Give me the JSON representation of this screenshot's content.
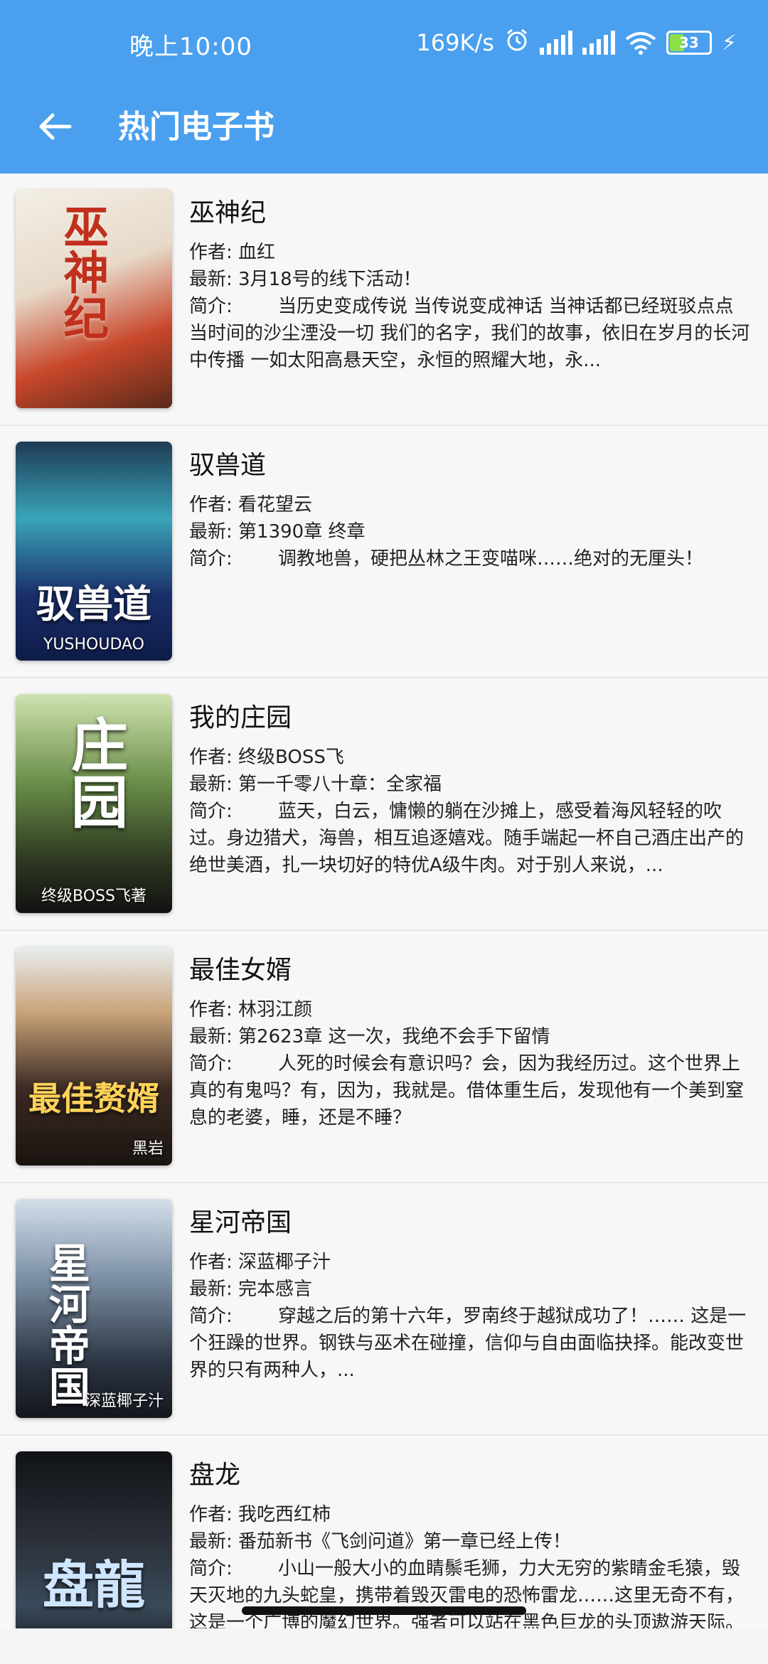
{
  "status": {
    "time": "晚上10:00",
    "speed": "169K/s",
    "battery": "33",
    "icons": [
      "alarm-icon",
      "signal-hd-icon",
      "signal-hd-icon",
      "wifi-icon",
      "battery-icon",
      "charging-icon"
    ]
  },
  "appbar": {
    "title": "热门电子书",
    "back_icon": "arrow-left-icon"
  },
  "labels": {
    "author": "作者: ",
    "latest": "最新: ",
    "intro": "简介: "
  },
  "books": [
    {
      "title": "巫神纪",
      "author": "血红",
      "latest": "3月18号的线下活动！",
      "intro": "当历史变成传说 当传说变成神话 当神话都已经斑驳点点 当时间的沙尘湮没一切 我们的名字，我们的故事，依旧在岁月的长河中传播 一如太阳高悬天空，永恒的照耀大地，永...",
      "cover_text": "巫神纪",
      "cover_sub": ""
    },
    {
      "title": "驭兽道",
      "author": "看花望云",
      "latest": "第1390章 终章",
      "intro": "调教地兽，硬把丛林之王变喵咪……绝对的无厘头！",
      "cover_text": "驭兽道",
      "cover_sub": "YUSHOUDAO"
    },
    {
      "title": "我的庄园",
      "author": "终级BOSS飞",
      "latest": "第一千零八十章：全家福",
      "intro": "蓝天，白云，慵懒的躺在沙摊上，感受着海风轻轻的吹过。身边猎犬，海兽，相互追逐嬉戏。随手端起一杯自己酒庄出产的绝世美酒，扎一块切好的特优A级牛肉。对于别人来说，...",
      "cover_text": "庄园",
      "cover_sub": "终级BOSS飞著"
    },
    {
      "title": "最佳女婿",
      "author": "林羽江颜",
      "latest": "第2623章 这一次，我绝不会手下留情",
      "intro": "人死的时候会有意识吗？会，因为我经历过。这个世界上真的有鬼吗？有，因为，我就是。借体重生后，发现他有一个美到窒息的老婆，睡，还是不睡？",
      "cover_text": "最佳赘婿",
      "cover_sub": "黑岩"
    },
    {
      "title": "星河帝国",
      "author": "深蓝椰子汁",
      "latest": "完本感言",
      "intro": "穿越之后的第十六年，罗南终于越狱成功了！…… 这是一个狂躁的世界。钢铁与巫术在碰撞，信仰与自由面临抉择。能改变世界的只有两种人，...",
      "cover_text": "星河帝国",
      "cover_sub": "深蓝椰子汁"
    },
    {
      "title": "盘龙",
      "author": "我吃西红柿",
      "latest": "番茄新书《飞剑问道》第一章已经上传！",
      "intro": "小山一般大小的血睛鬃毛狮，力大无穷的紫睛金毛猿，毁天灭地的九头蛇皇，携带着毁灭雷电的恐怖雷龙……这里无奇不有，这是一个广博的魔幻世界。强者可以站在黑色巨龙的头顶遨游天际。",
      "cover_text": "盘龍",
      "cover_sub": ""
    }
  ]
}
